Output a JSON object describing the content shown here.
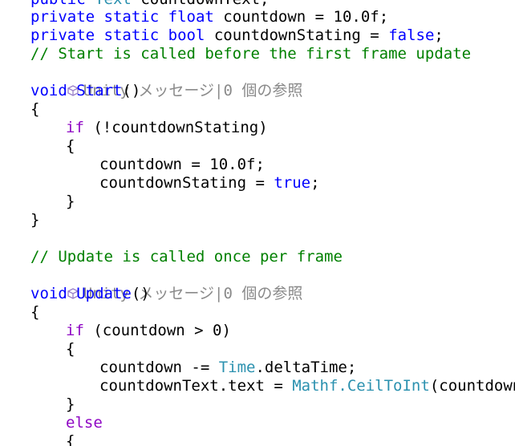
{
  "editor": {
    "line0": {
      "kw1": "public",
      "type": "Text",
      "rest": "countdownText;"
    },
    "line1": {
      "kw1": "private",
      "kw2": "static",
      "kw3": "float",
      "rest": "countdown = 10.0f;"
    },
    "line2": {
      "kw1": "private",
      "kw2": "static",
      "kw3": "bool",
      "rest": "countdownStating = ",
      "val": "false",
      "end": ";"
    },
    "comment1": "// Start is called before the first frame update",
    "lens1": "Unity メッセージ|0 個の参照",
    "start_sig": {
      "kw": "void",
      "name": "Start",
      "paren": "()"
    },
    "brace_open": "{",
    "brace_close": "}",
    "if1": {
      "kw": "if",
      "cond": "(!countdownStating)"
    },
    "assign1": "countdown = 10.0f;",
    "assign2": {
      "lhs": "countdownStating = ",
      "val": "true",
      "end": ";"
    },
    "comment2": "// Update is called once per frame",
    "lens2": "Unity メッセージ|0 個の参照",
    "update_sig": {
      "kw": "void",
      "name": "Update",
      "paren": "()"
    },
    "if2": {
      "kw": "if",
      "cond": "(countdown > 0)"
    },
    "dec": {
      "lhs": "countdown -= ",
      "type": "Time",
      "rest": ".deltaTime;"
    },
    "settext": {
      "lhs": "countdownText.text = ",
      "type": "Mathf",
      "method": ".CeilToInt",
      "rest": "(countdown).T"
    },
    "else_kw": "else"
  },
  "colors": {
    "keyword": "#0000ff",
    "control": "#8f08c4",
    "type": "#2b91af",
    "comment": "#008000",
    "codelens": "#8a8a8a"
  },
  "icons": {
    "codelens": "unity-cube-icon"
  }
}
